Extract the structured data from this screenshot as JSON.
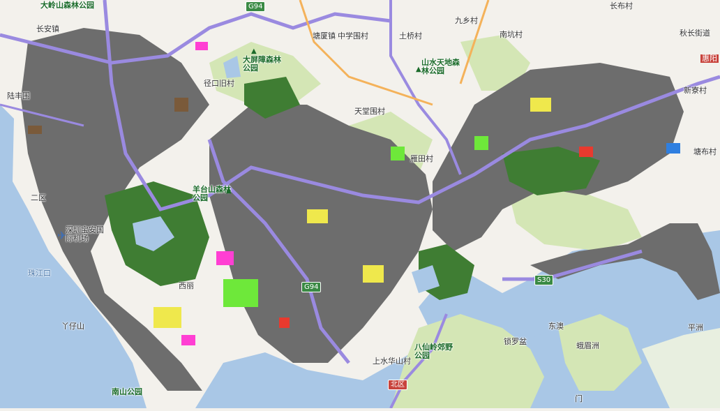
{
  "map": {
    "colors": {
      "land": "#f3f1ec",
      "water": "#a9c7e6",
      "park": "#d4e6b5",
      "forest": "#3f7d33",
      "urban_gray": "#6d6d6d",
      "yellow": "#efe84c",
      "green_lot": "#6ee83a",
      "magenta": "#ff3fd3",
      "brown": "#7a5a3a",
      "red": "#e83a2e",
      "blue_lot": "#2f7fe0",
      "highway_purple": "#9a8ae0",
      "road_orange": "#f4b25a"
    },
    "place_labels": [
      "大岭山森林公园",
      "长安镇",
      "塘厦镇",
      "中学围村",
      "土桥村",
      "九乡村",
      "南坑村",
      "秋长街道",
      "长布村",
      "惠阳",
      "山水天地森林公园",
      "大屏障森林公园",
      "径口旧村",
      "天堂围村",
      "雁田村",
      "新寮村",
      "塘布村",
      "陆丰围",
      "深圳宝安国际机场",
      "羊台山森林公园",
      "二区",
      "珠江口",
      "丫仔山",
      "西丽",
      "南山公园",
      "上水华山村",
      "八仙岭郊野公园",
      "东澳",
      "锁罗盆",
      "蛾眉洲",
      "平洲",
      "门"
    ],
    "road_shields": [
      "G94",
      "G94",
      "S30",
      "北区",
      "惠阳"
    ]
  }
}
